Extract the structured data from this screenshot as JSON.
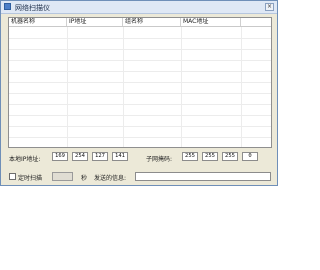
{
  "window": {
    "title": "网络扫描仪",
    "close_glyph": "×"
  },
  "list": {
    "columns": [
      "机器名称",
      "IP地址",
      "组名称",
      "MAC地址"
    ]
  },
  "local_ip": {
    "label": "本地IP地址:",
    "octets": [
      "169",
      "254",
      "127",
      "141"
    ]
  },
  "subnet": {
    "label": "子网掩码:",
    "octets": [
      "255",
      "255",
      "255",
      "0"
    ]
  },
  "scan": {
    "timer_label": "定时扫描",
    "seconds_unit": "秒",
    "send_label": "发送的信息:"
  },
  "icons": [
    "app-icon",
    "close-icon",
    "checkbox"
  ]
}
